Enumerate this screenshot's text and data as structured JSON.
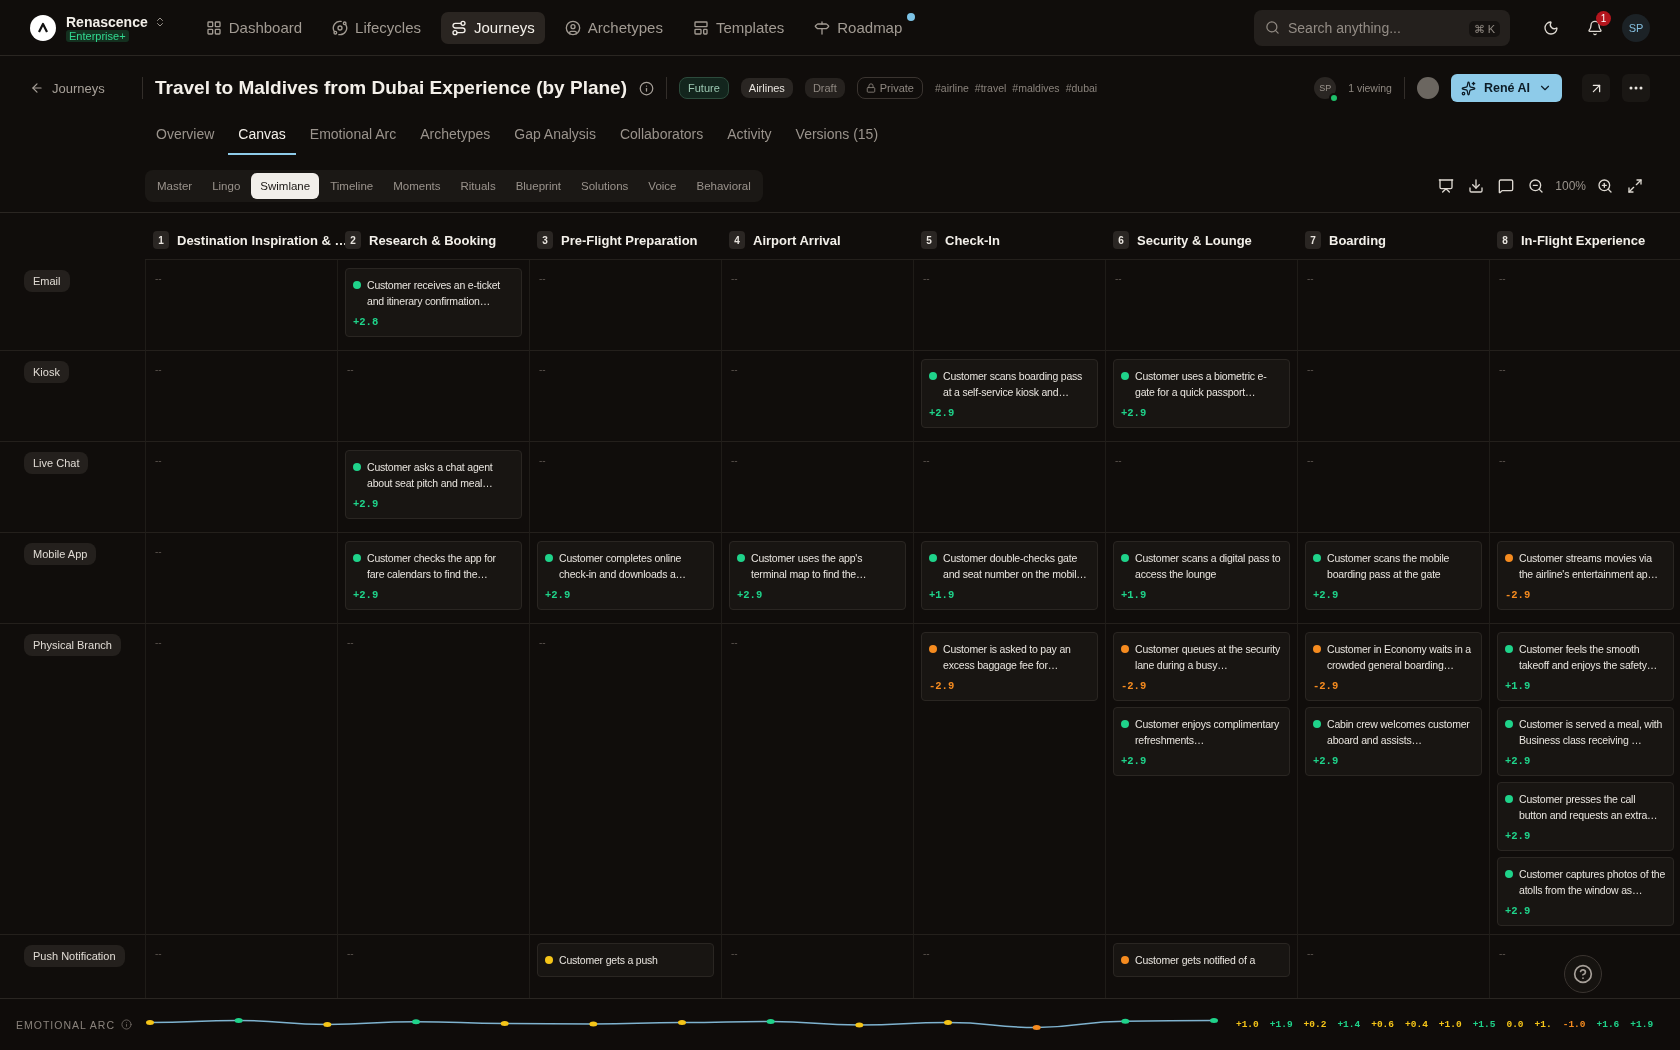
{
  "app": {
    "name": "Renascence",
    "plan": "Enterprise+"
  },
  "nav": [
    {
      "label": "Dashboard",
      "selected": false,
      "has_update": false
    },
    {
      "label": "Lifecycles",
      "selected": false,
      "has_update": false
    },
    {
      "label": "Journeys",
      "selected": true,
      "has_update": false
    },
    {
      "label": "Archetypes",
      "selected": false,
      "has_update": false
    },
    {
      "label": "Templates",
      "selected": false,
      "has_update": false
    },
    {
      "label": "Roadmap",
      "selected": false,
      "has_update": true
    }
  ],
  "search": {
    "placeholder": "Search anything...",
    "shortcut": "⌘ K"
  },
  "notifications": {
    "count": "1"
  },
  "user": {
    "initials": "SP"
  },
  "journey": {
    "back": "Journeys",
    "title": "Travel to Maldives from Dubai Experience (by Plane)",
    "tags": [
      {
        "label": "Future",
        "kind": "status"
      },
      {
        "label": "Airlines",
        "kind": "category"
      },
      {
        "label": "Draft",
        "kind": "draft"
      },
      {
        "label": "Private",
        "kind": "visibility"
      }
    ],
    "hashtags": [
      "#airline",
      "#travel",
      "#maldives",
      "#dubai"
    ],
    "viewer_initials": "SP",
    "viewers": "1 viewing",
    "ai_button": "René AI"
  },
  "tabs": [
    {
      "label": "Overview",
      "selected": false
    },
    {
      "label": "Canvas",
      "selected": true
    },
    {
      "label": "Emotional Arc",
      "selected": false
    },
    {
      "label": "Archetypes",
      "selected": false
    },
    {
      "label": "Gap Analysis",
      "selected": false
    },
    {
      "label": "Collaborators",
      "selected": false
    },
    {
      "label": "Activity",
      "selected": false
    },
    {
      "label": "Versions (15)",
      "selected": false
    }
  ],
  "views": [
    {
      "label": "Master",
      "selected": false
    },
    {
      "label": "Lingo",
      "selected": false
    },
    {
      "label": "Swimlane",
      "selected": true
    },
    {
      "label": "Timeline",
      "selected": false
    },
    {
      "label": "Moments",
      "selected": false
    },
    {
      "label": "Rituals",
      "selected": false
    },
    {
      "label": "Blueprint",
      "selected": false
    },
    {
      "label": "Solutions",
      "selected": false
    },
    {
      "label": "Voice",
      "selected": false
    },
    {
      "label": "Behavioral",
      "selected": false
    }
  ],
  "zoom": "100%",
  "stages": [
    {
      "number": "1",
      "name": "Destination Inspiration & …"
    },
    {
      "number": "2",
      "name": "Research & Booking"
    },
    {
      "number": "3",
      "name": "Pre-Flight Preparation"
    },
    {
      "number": "4",
      "name": "Airport Arrival"
    },
    {
      "number": "5",
      "name": "Check-In"
    },
    {
      "number": "6",
      "name": "Security & Lounge"
    },
    {
      "number": "7",
      "name": "Boarding"
    },
    {
      "number": "8",
      "name": "In-Flight Experience"
    }
  ],
  "lanes": [
    {
      "name": "Email",
      "cells": [
        {
          "empty": "--"
        },
        {
          "cards": [
            {
              "text": "Customer receives an e-ticket and itinerary confirmation…",
              "score": "+2.8",
              "color": "#1fd38a"
            }
          ]
        },
        {
          "empty": "--"
        },
        {
          "empty": "--"
        },
        {
          "empty": "--"
        },
        {
          "empty": "--"
        },
        {
          "empty": "--"
        },
        {
          "empty": "--"
        }
      ]
    },
    {
      "name": "Kiosk",
      "cells": [
        {
          "empty": "--"
        },
        {
          "empty": "--"
        },
        {
          "empty": "--"
        },
        {
          "empty": "--"
        },
        {
          "cards": [
            {
              "text": "Customer scans boarding pass at a self-service kiosk and…",
              "score": "+2.9",
              "color": "#1fd38a"
            }
          ]
        },
        {
          "cards": [
            {
              "text": "Customer uses a biometric e-gate for a quick passport…",
              "score": "+2.9",
              "color": "#1fd38a"
            }
          ]
        },
        {
          "empty": "--"
        },
        {
          "empty": "--"
        }
      ]
    },
    {
      "name": "Live Chat",
      "cells": [
        {
          "empty": "--"
        },
        {
          "cards": [
            {
              "text": "Customer asks a chat agent about seat pitch and meal…",
              "score": "+2.9",
              "color": "#1fd38a"
            }
          ]
        },
        {
          "empty": "--"
        },
        {
          "empty": "--"
        },
        {
          "empty": "--"
        },
        {
          "empty": "--"
        },
        {
          "empty": "--"
        },
        {
          "empty": "--"
        }
      ]
    },
    {
      "name": "Mobile App",
      "cells": [
        {
          "empty": "--"
        },
        {
          "cards": [
            {
              "text": "Customer checks the app for fare calendars to find the…",
              "score": "+2.9",
              "color": "#1fd38a"
            }
          ]
        },
        {
          "cards": [
            {
              "text": "Customer completes online check-in and downloads a…",
              "score": "+2.9",
              "color": "#1fd38a"
            }
          ]
        },
        {
          "cards": [
            {
              "text": "Customer uses the app's terminal map to find the…",
              "score": "+2.9",
              "color": "#1fd38a"
            }
          ]
        },
        {
          "cards": [
            {
              "text": "Customer double-checks gate and seat number on the mobil…",
              "score": "+1.9",
              "color": "#1fd38a"
            }
          ]
        },
        {
          "cards": [
            {
              "text": "Customer scans a digital pass to access the lounge",
              "score": "+1.9",
              "color": "#1fd38a"
            }
          ]
        },
        {
          "cards": [
            {
              "text": "Customer scans the mobile boarding pass at the gate",
              "score": "+2.9",
              "color": "#1fd38a"
            }
          ]
        },
        {
          "cards": [
            {
              "text": "Customer streams movies via the airline's entertainment ap…",
              "score": "-2.9",
              "color": "#f58b1f"
            }
          ]
        }
      ]
    },
    {
      "name": "Physical Branch",
      "cells": [
        {
          "empty": "--"
        },
        {
          "empty": "--"
        },
        {
          "empty": "--"
        },
        {
          "empty": "--"
        },
        {
          "cards": [
            {
              "text": "Customer is asked to pay an excess baggage fee for…",
              "score": "-2.9",
              "color": "#f58b1f"
            }
          ]
        },
        {
          "cards": [
            {
              "text": "Customer queues at the security lane during a busy…",
              "score": "-2.9",
              "color": "#f58b1f"
            },
            {
              "text": "Customer enjoys complimentary refreshments…",
              "score": "+2.9",
              "color": "#1fd38a"
            }
          ]
        },
        {
          "cards": [
            {
              "text": "Customer in Economy waits in a crowded general boarding…",
              "score": "-2.9",
              "color": "#f58b1f"
            },
            {
              "text": "Cabin crew welcomes customer aboard and assists…",
              "score": "+2.9",
              "color": "#1fd38a"
            }
          ]
        },
        {
          "cards": [
            {
              "text": "Customer feels the smooth takeoff and enjoys the safety…",
              "score": "+1.9",
              "color": "#1fd38a"
            },
            {
              "text": "Customer is served a meal, with Business class receiving …",
              "score": "+2.9",
              "color": "#1fd38a"
            },
            {
              "text": "Customer presses the call button and requests an extra…",
              "score": "+2.9",
              "color": "#1fd38a"
            },
            {
              "text": "Customer captures photos of the atolls from the window as…",
              "score": "+2.9",
              "color": "#1fd38a"
            }
          ]
        }
      ]
    },
    {
      "name": "Push Notification",
      "cells": [
        {
          "empty": "--"
        },
        {
          "empty": "--"
        },
        {
          "cards": [
            {
              "text": "Customer gets a push",
              "color": "#f5c518"
            }
          ]
        },
        {
          "empty": "--"
        },
        {
          "empty": "--"
        },
        {
          "cards": [
            {
              "text": "Customer gets notified of a",
              "color": "#f58b1f"
            }
          ]
        },
        {
          "empty": "--"
        },
        {
          "empty": "--"
        }
      ]
    }
  ],
  "emotional_arc": {
    "label": "EMOTIONAL ARC",
    "values": [
      {
        "value": "+1.0",
        "color": "#f5c518"
      },
      {
        "value": "+1.9",
        "color": "#1fd38a"
      },
      {
        "value": "+0.2",
        "color": "#f5c518"
      },
      {
        "value": "+1.4",
        "color": "#1fd38a"
      },
      {
        "value": "+0.6",
        "color": "#f5c518"
      },
      {
        "value": "+0.4",
        "color": "#f5c518"
      },
      {
        "value": "+1.0",
        "color": "#f5c518"
      },
      {
        "value": "+1.5",
        "color": "#1fd38a"
      },
      {
        "value": "0.0",
        "color": "#f5c518"
      },
      {
        "value": "+1.",
        "color": "#f5c518"
      },
      {
        "value": "-1.0",
        "color": "#f58b1f"
      },
      {
        "value": "+1.6",
        "color": "#1fd38a"
      },
      {
        "value": "+1.9",
        "color": "#1fd38a"
      }
    ]
  }
}
